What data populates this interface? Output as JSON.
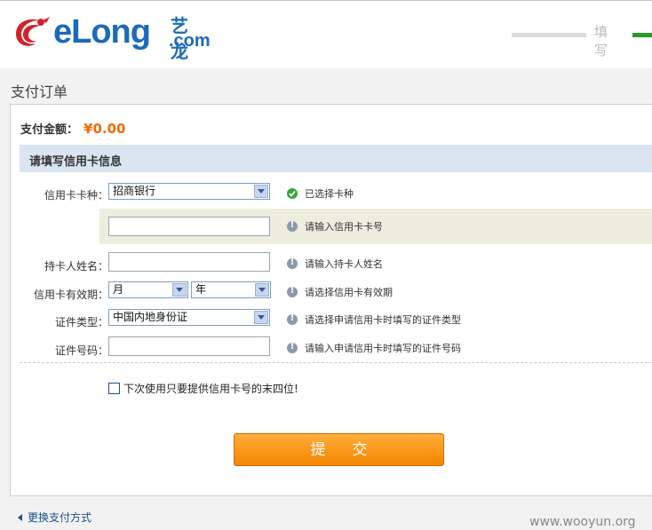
{
  "header": {
    "brand": "eLong",
    "brand_cn": "艺龙",
    "brand_com": ".com",
    "step_label": "填写"
  },
  "page": {
    "title": "支付订单"
  },
  "payment": {
    "amount_label": "支付金额：",
    "amount_value": "¥0.00"
  },
  "form": {
    "section_title": "请填写信用卡信息",
    "card_type": {
      "label": "信用卡卡种：",
      "value": "招商银行",
      "hint": "已选择卡种"
    },
    "card_number": {
      "value": "",
      "hint": "请输入信用卡卡号"
    },
    "holder_name": {
      "label": "持卡人姓名：",
      "value": "",
      "hint": "请输入持卡人姓名"
    },
    "expiry": {
      "label": "信用卡有效期：",
      "month": "月",
      "year": "年",
      "hint": "请选择信用卡有效期"
    },
    "id_type": {
      "label": "证件类型：",
      "value": "中国内地身份证",
      "hint": "请选择申请信用卡时填写的证件类型"
    },
    "id_number": {
      "label": "证件号码：",
      "value": "",
      "hint": "请输入申请信用卡时填写的证件号码"
    },
    "remember_label": "下次使用只要提供信用卡号的末四位!",
    "submit_label": "提交"
  },
  "footer": {
    "back_link": "更换支付方式",
    "watermark": "www.wooyun.org"
  },
  "colors": {
    "brand_blue": "#1b6bb8",
    "accent_orange": "#f06a00",
    "success_green": "#3aa53a"
  }
}
